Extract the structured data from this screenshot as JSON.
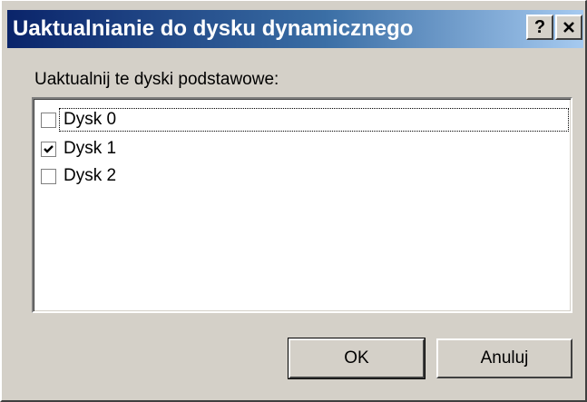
{
  "window": {
    "title": "Uaktualnianie do dysku dynamicznego",
    "help_label": "?",
    "close_icon": "close-icon"
  },
  "disk_list": {
    "label": "Uaktualnij te dyski podstawowe:",
    "items": [
      {
        "label": "Dysk 0",
        "checked": false,
        "focused": true
      },
      {
        "label": "Dysk 1",
        "checked": true,
        "focused": false
      },
      {
        "label": "Dysk 2",
        "checked": false,
        "focused": false
      }
    ]
  },
  "buttons": {
    "ok_label": "OK",
    "cancel_label": "Anuluj"
  },
  "colors": {
    "title_gradient_start": "#0a246a",
    "title_gradient_end": "#a6caf0",
    "dialog_face": "#d4d0c8"
  }
}
